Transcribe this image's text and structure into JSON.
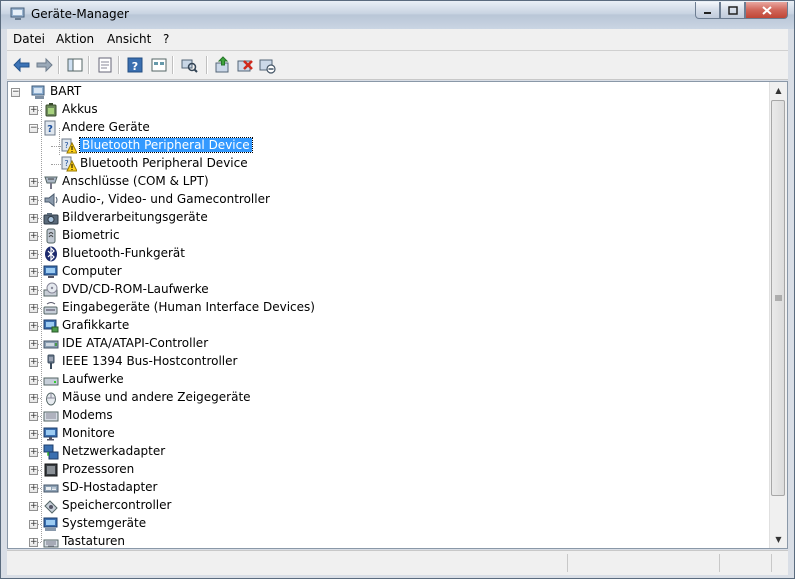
{
  "window": {
    "title": "Geräte-Manager"
  },
  "menu": [
    {
      "label": "Datei",
      "name": "menu-datei"
    },
    {
      "label": "Aktion",
      "name": "menu-aktion"
    },
    {
      "label": "Ansicht",
      "name": "menu-ansicht"
    },
    {
      "label": "?",
      "name": "menu-help"
    }
  ],
  "toolbar": [
    {
      "name": "back-icon"
    },
    {
      "name": "forward-icon"
    },
    {
      "name": "show-hide-console-tree-icon"
    },
    {
      "name": "properties-icon"
    },
    {
      "name": "help-icon"
    },
    {
      "name": "view-icon"
    },
    {
      "name": "scan-hardware-icon"
    },
    {
      "name": "update-driver-icon"
    },
    {
      "name": "uninstall-icon"
    },
    {
      "name": "disable-icon"
    }
  ],
  "tree": {
    "root": "BART",
    "items": [
      {
        "label": "Akkus",
        "icon": "battery-icon",
        "expanded": false
      },
      {
        "label": "Andere Geräte",
        "icon": "unknown-device-icon",
        "expanded": true,
        "children": [
          {
            "label": "Bluetooth Peripheral Device",
            "icon": "warning-device-icon",
            "selected": true
          },
          {
            "label": "Bluetooth Peripheral Device",
            "icon": "warning-device-icon",
            "selected": false
          }
        ]
      },
      {
        "label": "Anschlüsse (COM & LPT)",
        "icon": "port-icon",
        "expanded": false
      },
      {
        "label": "Audio-, Video- und Gamecontroller",
        "icon": "speaker-icon",
        "expanded": false
      },
      {
        "label": "Bildverarbeitungsgeräte",
        "icon": "camera-icon",
        "expanded": false
      },
      {
        "label": "Biometric",
        "icon": "biometric-icon",
        "expanded": false
      },
      {
        "label": "Bluetooth-Funkgerät",
        "icon": "bluetooth-icon",
        "expanded": false
      },
      {
        "label": "Computer",
        "icon": "computer-icon",
        "expanded": false
      },
      {
        "label": "DVD/CD-ROM-Laufwerke",
        "icon": "dvd-drive-icon",
        "expanded": false
      },
      {
        "label": "Eingabegeräte (Human Interface Devices)",
        "icon": "hid-icon",
        "expanded": false
      },
      {
        "label": "Grafikkarte",
        "icon": "display-adapter-icon",
        "expanded": false
      },
      {
        "label": "IDE ATA/ATAPI-Controller",
        "icon": "ide-controller-icon",
        "expanded": false
      },
      {
        "label": "IEEE 1394 Bus-Hostcontroller",
        "icon": "firewire-icon",
        "expanded": false
      },
      {
        "label": "Laufwerke",
        "icon": "disk-drive-icon",
        "expanded": false
      },
      {
        "label": "Mäuse und andere Zeigegeräte",
        "icon": "mouse-icon",
        "expanded": false
      },
      {
        "label": "Modems",
        "icon": "modem-icon",
        "expanded": false
      },
      {
        "label": "Monitore",
        "icon": "monitor-icon",
        "expanded": false
      },
      {
        "label": "Netzwerkadapter",
        "icon": "network-adapter-icon",
        "expanded": false
      },
      {
        "label": "Prozessoren",
        "icon": "processor-icon",
        "expanded": false
      },
      {
        "label": "SD-Hostadapter",
        "icon": "sd-host-icon",
        "expanded": false
      },
      {
        "label": "Speichercontroller",
        "icon": "storage-controller-icon",
        "expanded": false
      },
      {
        "label": "Systemgeräte",
        "icon": "system-device-icon",
        "expanded": false
      },
      {
        "label": "Tastaturen",
        "icon": "keyboard-icon",
        "expanded": false
      }
    ]
  },
  "colors": {
    "selection": "#3399ff",
    "titlebar": "#c9d4e2",
    "close_button": "#c04636"
  }
}
